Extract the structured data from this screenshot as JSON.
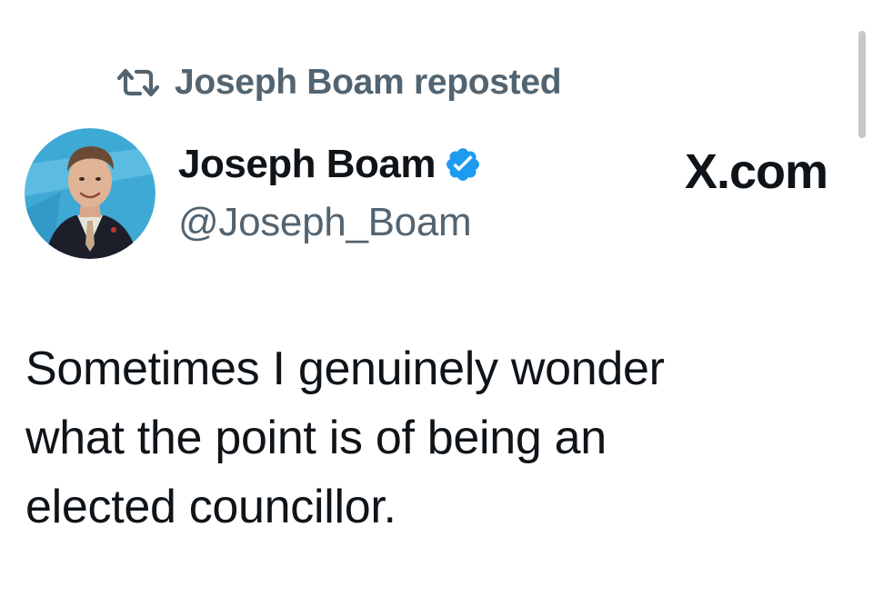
{
  "repost": {
    "label": "Joseph Boam reposted",
    "icon": "repost-icon"
  },
  "author": {
    "name": "Joseph Boam",
    "handle": "@Joseph_Boam",
    "verified": true,
    "verified_icon": "verified-badge-icon",
    "verified_color": "#1d9bf0"
  },
  "site_mark": "X.com",
  "tweet": {
    "lines": [
      "Sometimes I genuinely wonder",
      "what the point is of being an",
      "elected councillor."
    ]
  },
  "colors": {
    "text": "#0f1419",
    "secondary": "#536471",
    "accent": "#1d9bf0"
  }
}
